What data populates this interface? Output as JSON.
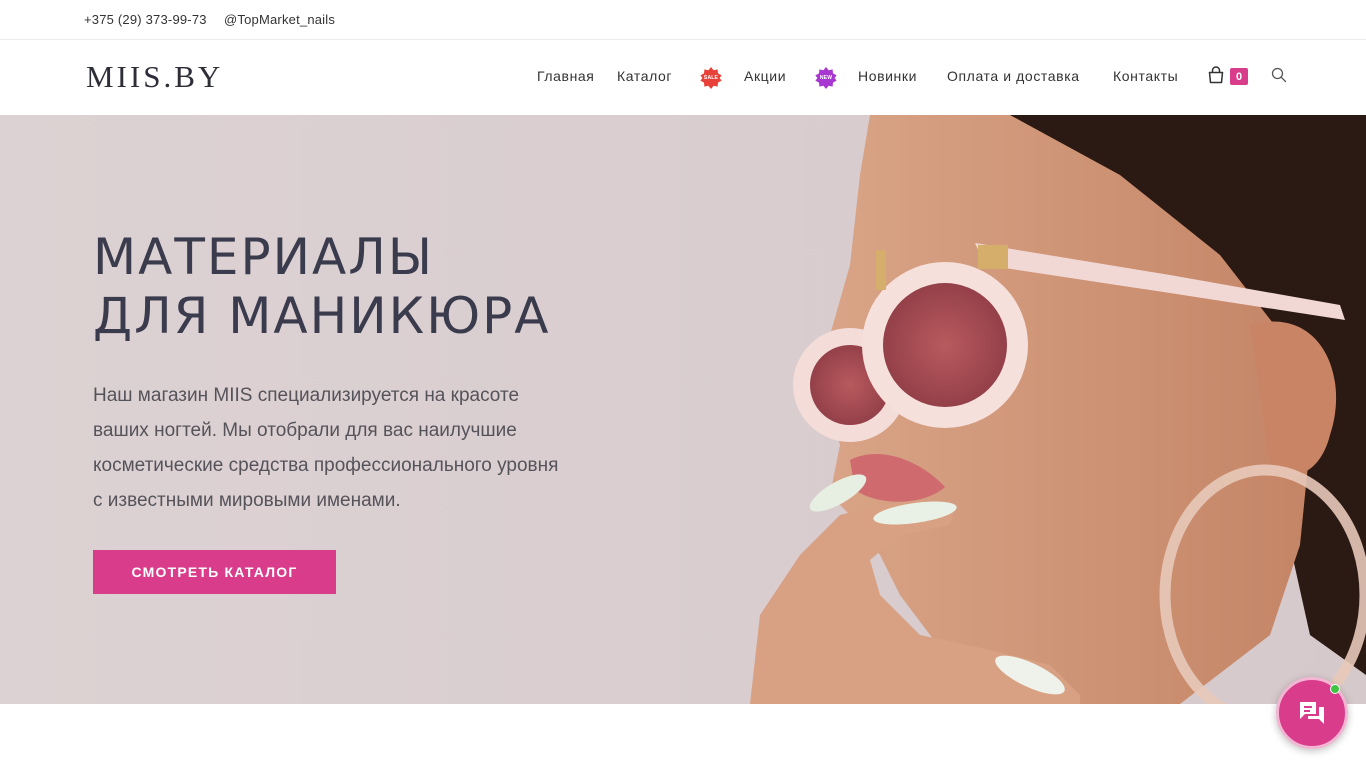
{
  "topbar": {
    "phone": "+375 (29) 373-99-73",
    "instagram": "@TopMarket_nails"
  },
  "header": {
    "logo": "MIIS.BY",
    "nav": {
      "home": "Главная",
      "catalog": "Каталог",
      "sale_badge": "SALE",
      "promo": "Акции",
      "new_badge": "NEW",
      "new_items": "Новинки",
      "payment": "Оплата и доставка",
      "contacts": "Контакты"
    },
    "cart_count": "0"
  },
  "hero": {
    "title_line1": "МАТЕРИАЛЫ",
    "title_line2": "ДЛЯ МАНИКЮРА",
    "desc_line1": "Наш магазин MIIS специализируется на красоте",
    "desc_line2": "ваших ногтей. Мы отобрали для вас наилучшие",
    "desc_line3": "косметические средства профессионального уровня",
    "desc_line4": "с известными мировыми именами.",
    "button": "СМОТРЕТЬ КАТАЛОГ"
  },
  "colors": {
    "accent": "#d93c8a",
    "sale_badge": "#e8413a",
    "new_badge": "#a837d1",
    "title": "#3a3b4c",
    "online": "#3ec43e"
  }
}
